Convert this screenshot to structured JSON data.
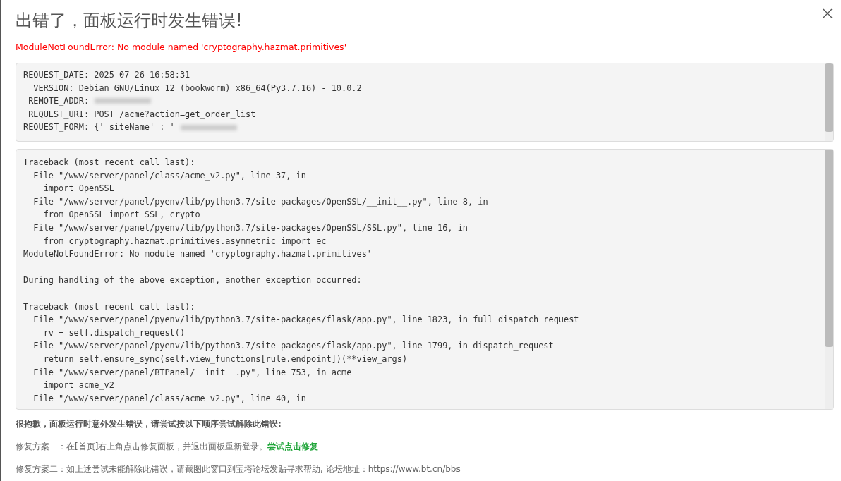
{
  "dialog": {
    "title": "出错了，面板运行时发生错误!",
    "error_message": "ModuleNotFoundError: No module named 'cryptography.hazmat.primitives'"
  },
  "request_info": [
    {
      "text": "REQUEST_DATE: 2025-07-26 16:58:31",
      "redacted": false
    },
    {
      "text": "  VERSION: Debian GNU/Linux 12 (bookworm) x86_64(Py3.7.16) - 10.0.2",
      "redacted": false
    },
    {
      "text": " REMOTE_ADDR:",
      "redacted": true
    },
    {
      "text": " REQUEST_URI: POST /acme?action=get_order_list",
      "redacted": false
    },
    {
      "text": "REQUEST_FORM: {' siteName' : '",
      "redacted": true
    }
  ],
  "traceback": [
    [
      "Traceback (most recent call last):",
      "  File \"/www/server/panel/class/acme_v2.py\", line 37, in",
      "    import OpenSSL",
      "  File \"/www/server/panel/pyenv/lib/python3.7/site-packages/OpenSSL/__init__.py\", line 8, in",
      "    from OpenSSL import SSL, crypto",
      "  File \"/www/server/panel/pyenv/lib/python3.7/site-packages/OpenSSL/SSL.py\", line 16, in",
      "    from cryptography.hazmat.primitives.asymmetric import ec",
      "ModuleNotFoundError: No module named 'cryptography.hazmat.primitives'"
    ],
    [
      "During handling of the above exception, another exception occurred:"
    ],
    [
      "Traceback (most recent call last):",
      "  File \"/www/server/panel/pyenv/lib/python3.7/site-packages/flask/app.py\", line 1823, in full_dispatch_request",
      "    rv = self.dispatch_request()",
      "  File \"/www/server/panel/pyenv/lib/python3.7/site-packages/flask/app.py\", line 1799, in dispatch_request",
      "    return self.ensure_sync(self.view_functions[rule.endpoint])(**view_args)",
      "  File \"/www/server/panel/BTPanel/__init__.py\", line 753, in acme",
      "    import acme_v2",
      "  File \"/www/server/panel/class/acme_v2.py\", line 40, in"
    ]
  ],
  "help": {
    "heading": "很抱歉，面板运行时意外发生错误，请尝试按以下顺序尝试解除此错误:",
    "fix_1": "修复方案一：在[首页]右上角点击修复面板，并退出面板重新登录。",
    "fix_1_link": "尝试点击修复",
    "fix_2": "修复方案二：如上述尝试未能解除此错误，请截图此窗口到宝塔论坛发贴寻求帮助, 论坛地址：https://www.bt.cn/bbs"
  }
}
